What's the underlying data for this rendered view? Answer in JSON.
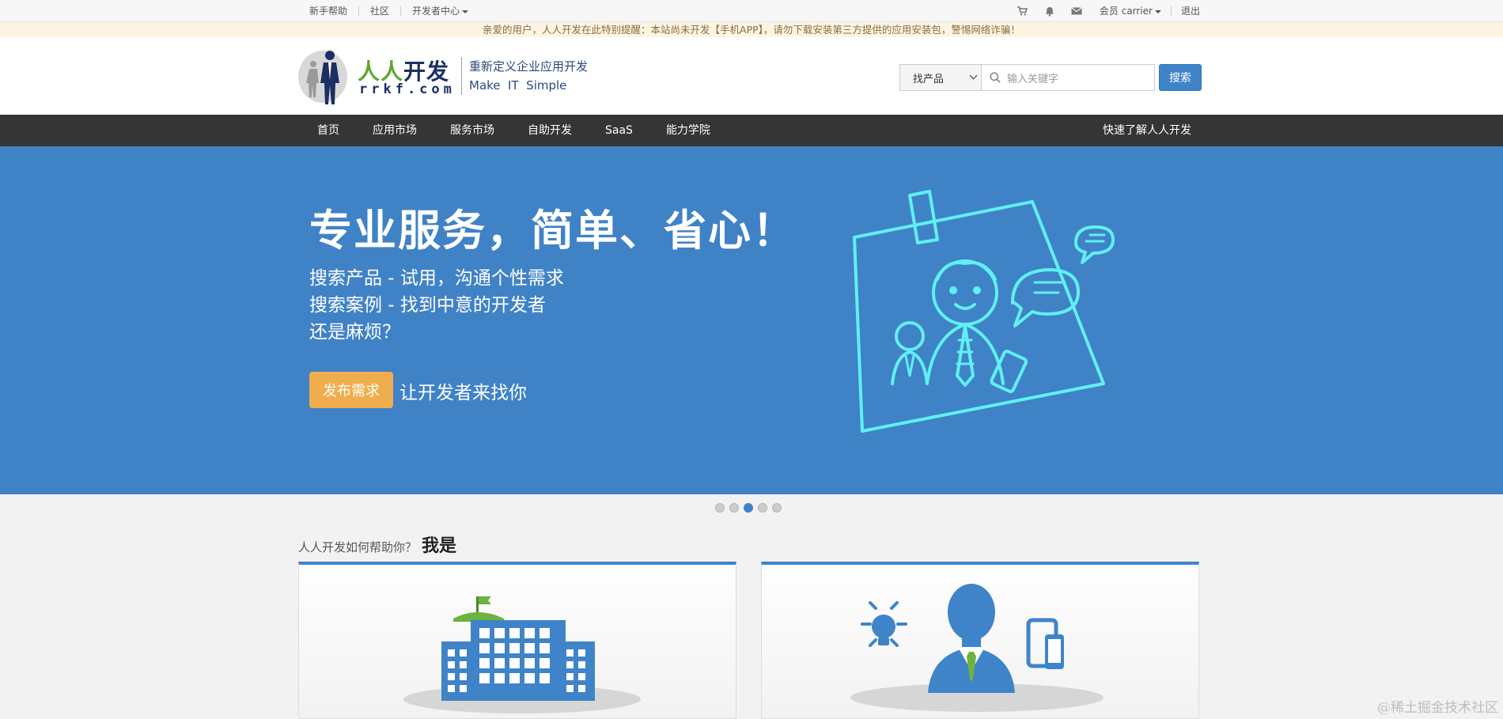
{
  "topbar": {
    "left": [
      "新手帮助",
      "社区",
      "开发者中心"
    ],
    "member": "会员 carrier",
    "logout": "退出"
  },
  "notice": "亲爱的用户，人人开发在此特别提醒：本站尚未开发【手机APP】，请勿下载安装第三方提供的应用安装包，警惕网络诈骗！",
  "header": {
    "logo_cn_green": "人人",
    "logo_cn_dark": "开发",
    "logo_en": "rrkf.com",
    "slogan_line1": "重新定义企业应用开发",
    "slogan_line2": "Make  IT  Simple"
  },
  "search": {
    "select_value": "找产品",
    "placeholder": "输入关键字",
    "button": "搜索"
  },
  "nav": {
    "items": [
      "首页",
      "应用市场",
      "服务市场",
      "自助开发",
      "SaaS",
      "能力学院"
    ],
    "right": "快速了解人人开发"
  },
  "banner": {
    "headline": "专业服务，简单、省心！",
    "line1": "搜索产品 - 试用，沟通个性需求",
    "line2": "搜索案例 - 找到中意的开发者",
    "line3": "还是麻烦？",
    "cta_button": "发布需求",
    "cta_text": "让开发者来找你"
  },
  "carousel": {
    "count": 5,
    "active_index": 2
  },
  "help": {
    "prefix": "人人开发如何帮助你？",
    "strong": "我是"
  },
  "watermark": "@稀土掘金技术社区",
  "colors": {
    "primary": "#3f84c8",
    "banner": "#4082c6",
    "cta": "#f0ad4e",
    "nav": "#353535",
    "illustration": "#5ff0f5"
  }
}
